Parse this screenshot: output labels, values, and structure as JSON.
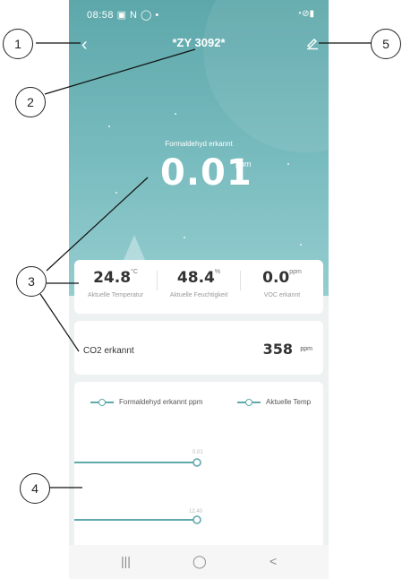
{
  "status_bar": {
    "time": "08:58 ▣ N ◯ •",
    "right": "◔⊘▮"
  },
  "header": {
    "back_icon": "chevron-left-icon",
    "title": "*ZY 3092*",
    "edit_icon": "edit-icon"
  },
  "formaldehyde": {
    "label": "Formaldehyd erkannt",
    "value": "0.01",
    "unit": "ppm"
  },
  "metrics": [
    {
      "value": "24.8",
      "unit": "°C",
      "label": "Aktuelle Temperatur"
    },
    {
      "value": "48.4",
      "unit": "%",
      "label": "Aktuelle Feuchtigkeit"
    },
    {
      "value": "0.0",
      "unit": "ppm",
      "label": "VOC erkannt"
    }
  ],
  "co2": {
    "label": "CO2 erkannt",
    "value": "358",
    "unit": "ppm"
  },
  "chart": {
    "legend": [
      "Formaldehyd erkannt ppm",
      "Aktuelle Temp"
    ],
    "series": [
      {
        "name": "Formaldehyd erkannt ppm",
        "last_value_label": "0.01"
      },
      {
        "name": "Aktuelle Temp",
        "last_value_label": "12.40"
      }
    ]
  },
  "navbar": {
    "recent": "|||",
    "home": "◯",
    "back": "<"
  },
  "callouts": [
    "1",
    "2",
    "3",
    "4",
    "5"
  ],
  "colors": {
    "accent": "#5fa9ad",
    "hero_top": "#5da7aa",
    "hero_bottom": "#95cdd0"
  }
}
